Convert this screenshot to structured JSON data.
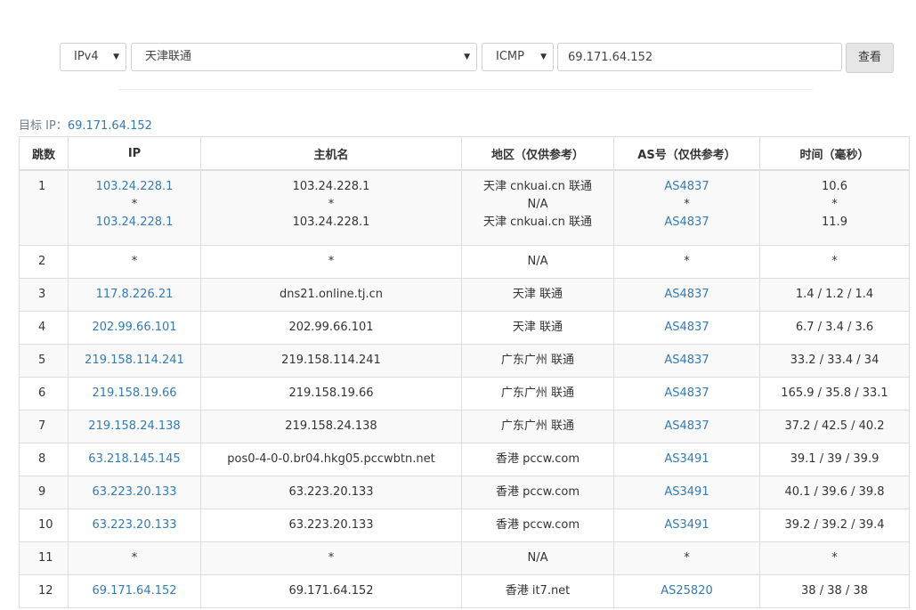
{
  "toolbar": {
    "protocol_version": "IPv4",
    "node": "天津联通",
    "method": "ICMP",
    "target_value": "69.171.64.152",
    "query_label": "查看",
    "caret": "▼"
  },
  "target": {
    "label": "目标 IP：",
    "ip": "69.171.64.152"
  },
  "table": {
    "headers": [
      "跳数",
      "IP",
      "主机名",
      "地区（仅供参考）",
      "AS号（仅供参考）",
      "时间（毫秒）"
    ],
    "rows": [
      {
        "hop": "1",
        "ip": [
          "103.24.228.1",
          "*",
          "103.24.228.1"
        ],
        "host": [
          "103.24.228.1",
          "*",
          "103.24.228.1"
        ],
        "region": [
          "天津 cnkuai.cn 联通",
          "N/A",
          "天津 cnkuai.cn 联通"
        ],
        "as": [
          "AS4837",
          "*",
          "AS4837"
        ],
        "time": [
          "10.6",
          "*",
          "11.9"
        ]
      },
      {
        "hop": "2",
        "ip": [
          "*"
        ],
        "host": [
          "*"
        ],
        "region": [
          "N/A"
        ],
        "as": [
          "*"
        ],
        "time": [
          "*"
        ]
      },
      {
        "hop": "3",
        "ip": [
          "117.8.226.21"
        ],
        "host": [
          "dns21.online.tj.cn"
        ],
        "region": [
          "天津 联通"
        ],
        "as": [
          "AS4837"
        ],
        "time": [
          "1.4 / 1.2 / 1.4"
        ]
      },
      {
        "hop": "4",
        "ip": [
          "202.99.66.101"
        ],
        "host": [
          "202.99.66.101"
        ],
        "region": [
          "天津 联通"
        ],
        "as": [
          "AS4837"
        ],
        "time": [
          "6.7 / 3.4 / 3.6"
        ]
      },
      {
        "hop": "5",
        "ip": [
          "219.158.114.241"
        ],
        "host": [
          "219.158.114.241"
        ],
        "region": [
          "广东广州 联通"
        ],
        "as": [
          "AS4837"
        ],
        "time": [
          "33.2 / 33.4 / 34"
        ]
      },
      {
        "hop": "6",
        "ip": [
          "219.158.19.66"
        ],
        "host": [
          "219.158.19.66"
        ],
        "region": [
          "广东广州 联通"
        ],
        "as": [
          "AS4837"
        ],
        "time": [
          "165.9 / 35.8 / 33.1"
        ]
      },
      {
        "hop": "7",
        "ip": [
          "219.158.24.138"
        ],
        "host": [
          "219.158.24.138"
        ],
        "region": [
          "广东广州 联通"
        ],
        "as": [
          "AS4837"
        ],
        "time": [
          "37.2 / 42.5 / 40.2"
        ]
      },
      {
        "hop": "8",
        "ip": [
          "63.218.145.145"
        ],
        "host": [
          "pos0-4-0-0.br04.hkg05.pccwbtn.net"
        ],
        "region": [
          "香港 pccw.com"
        ],
        "as": [
          "AS3491"
        ],
        "time": [
          "39.1 / 39 / 39.9"
        ]
      },
      {
        "hop": "9",
        "ip": [
          "63.223.20.133"
        ],
        "host": [
          "63.223.20.133"
        ],
        "region": [
          "香港 pccw.com"
        ],
        "as": [
          "AS3491"
        ],
        "time": [
          "40.1 / 39.6 / 39.8"
        ]
      },
      {
        "hop": "10",
        "ip": [
          "63.223.20.133"
        ],
        "host": [
          "63.223.20.133"
        ],
        "region": [
          "香港 pccw.com"
        ],
        "as": [
          "AS3491"
        ],
        "time": [
          "39.2 / 39.2 / 39.4"
        ]
      },
      {
        "hop": "11",
        "ip": [
          "*"
        ],
        "host": [
          "*"
        ],
        "region": [
          "N/A"
        ],
        "as": [
          "*"
        ],
        "time": [
          "*"
        ]
      },
      {
        "hop": "12",
        "ip": [
          "69.171.64.152"
        ],
        "host": [
          "69.171.64.152"
        ],
        "region": [
          "香港 it7.net"
        ],
        "as": [
          "AS25820"
        ],
        "time": [
          "38 / 38 / 38"
        ]
      }
    ]
  }
}
